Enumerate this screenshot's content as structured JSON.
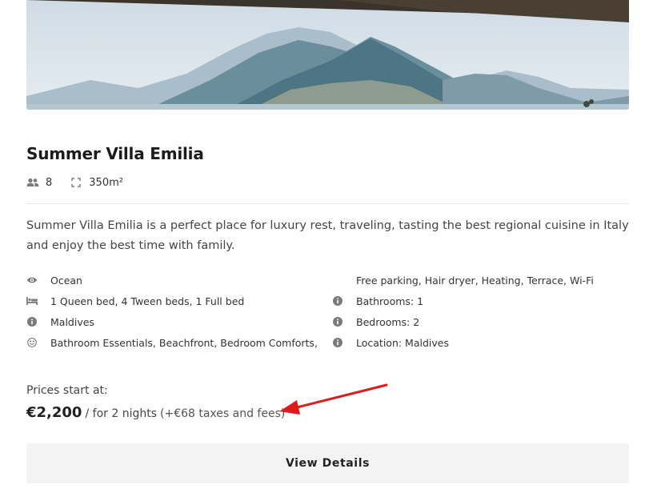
{
  "hero": {
    "image_description": "Mountain landscape over a hazy lake with a village on the hillside",
    "colors": {
      "sky": "#dfe8ef",
      "mountain_far": "#9fb6c6",
      "mountain_near": "#5b7f8e",
      "lake": "#b9ccd6"
    }
  },
  "listing": {
    "title": "Summer Villa Emilia",
    "guests": "8",
    "area": "350m²",
    "description": "Summer Villa Emilia is a perfect place for luxury rest, traveling, tasting the best regional cuisine in Italy and enjoy the best time with family."
  },
  "features_left": [
    {
      "icon": "eye-icon",
      "text": "Ocean"
    },
    {
      "icon": "bed-icon",
      "text": "1 Queen bed, 4 Tween beds, 1 Full bed"
    },
    {
      "icon": "info-icon",
      "text": "Maldives"
    },
    {
      "icon": "smile-icon",
      "text": "Bathroom Essentials, Beachfront, Bedroom Comforts,"
    }
  ],
  "features_right": [
    {
      "icon": "",
      "text": "Free parking, Hair dryer, Heating, Terrace, Wi-Fi"
    },
    {
      "icon": "info-icon",
      "text": "Bathrooms: 1"
    },
    {
      "icon": "info-icon",
      "text": "Bedrooms: 2"
    },
    {
      "icon": "info-icon",
      "text": "Location: Maldives"
    }
  ],
  "pricing": {
    "label": "Prices start at:",
    "amount": "€2,200",
    "per": "/ for 2 nights",
    "taxes": "(+€68 taxes and fees)"
  },
  "cta": {
    "label": "View Details"
  },
  "colors": {
    "annotation_arrow": "#e01b1b",
    "cta_bg": "#f3f3f3",
    "divider": "#e6e6e6"
  }
}
